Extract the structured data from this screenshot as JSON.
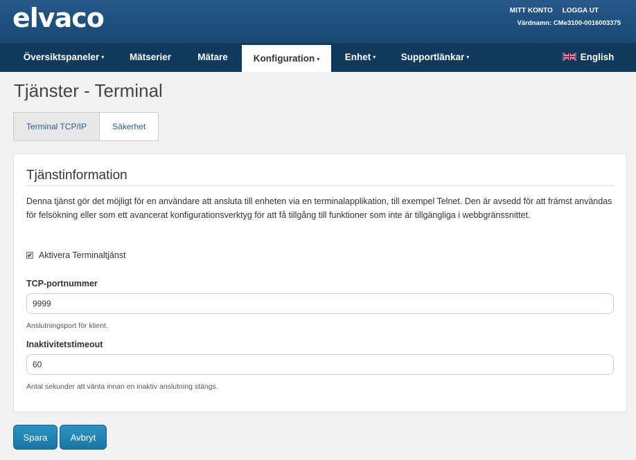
{
  "header": {
    "logo_text": "elvaco",
    "account_link": "MITT KONTO",
    "logout_link": "LOGGA UT",
    "hostname": "Värdnamn: CMe3100-0016003375"
  },
  "nav": {
    "items": [
      {
        "label": "Översiktspaneler",
        "dropdown": true
      },
      {
        "label": "Mätserier",
        "dropdown": false
      },
      {
        "label": "Mätare",
        "dropdown": false
      },
      {
        "label": "Konfiguration",
        "dropdown": true,
        "active": true
      },
      {
        "label": "Enhet",
        "dropdown": true
      },
      {
        "label": "Supportlänkar",
        "dropdown": true
      }
    ],
    "language": "English",
    "caret": "▾"
  },
  "page": {
    "title": "Tjänster - Terminal",
    "tabs": [
      {
        "label": "Terminal TCP/IP",
        "active": true
      },
      {
        "label": "Säkerhet",
        "active": false
      }
    ]
  },
  "panel": {
    "heading": "Tjänstinformation",
    "description": "Denna tjänst gör det möjligt för en användare att ansluta till enheten via en terminalapplikation, till exempel Telnet. Den är avsedd för att främst användas för felsökning eller som ett avancerat konfigurationsverktyg för att få tillgång till funktioner som inte är tillgängliga i webbgränssnittet.",
    "enable_label": "Aktivera Terminaltjänst",
    "enable_checked": true,
    "port_label": "TCP-portnummer",
    "port_value": "9999",
    "port_help": "Anslutningsport för klient.",
    "timeout_label": "Inaktivitetstimeout",
    "timeout_value": "60",
    "timeout_help": "Antal sekunder att vänta innan en inaktiv anslutning stängs."
  },
  "actions": {
    "save_label": "Spara",
    "cancel_label": "Avbryt"
  },
  "colors": {
    "header_bg": "#1f5080",
    "nav_bg": "#0f3a5e",
    "button": "#2285b6"
  }
}
